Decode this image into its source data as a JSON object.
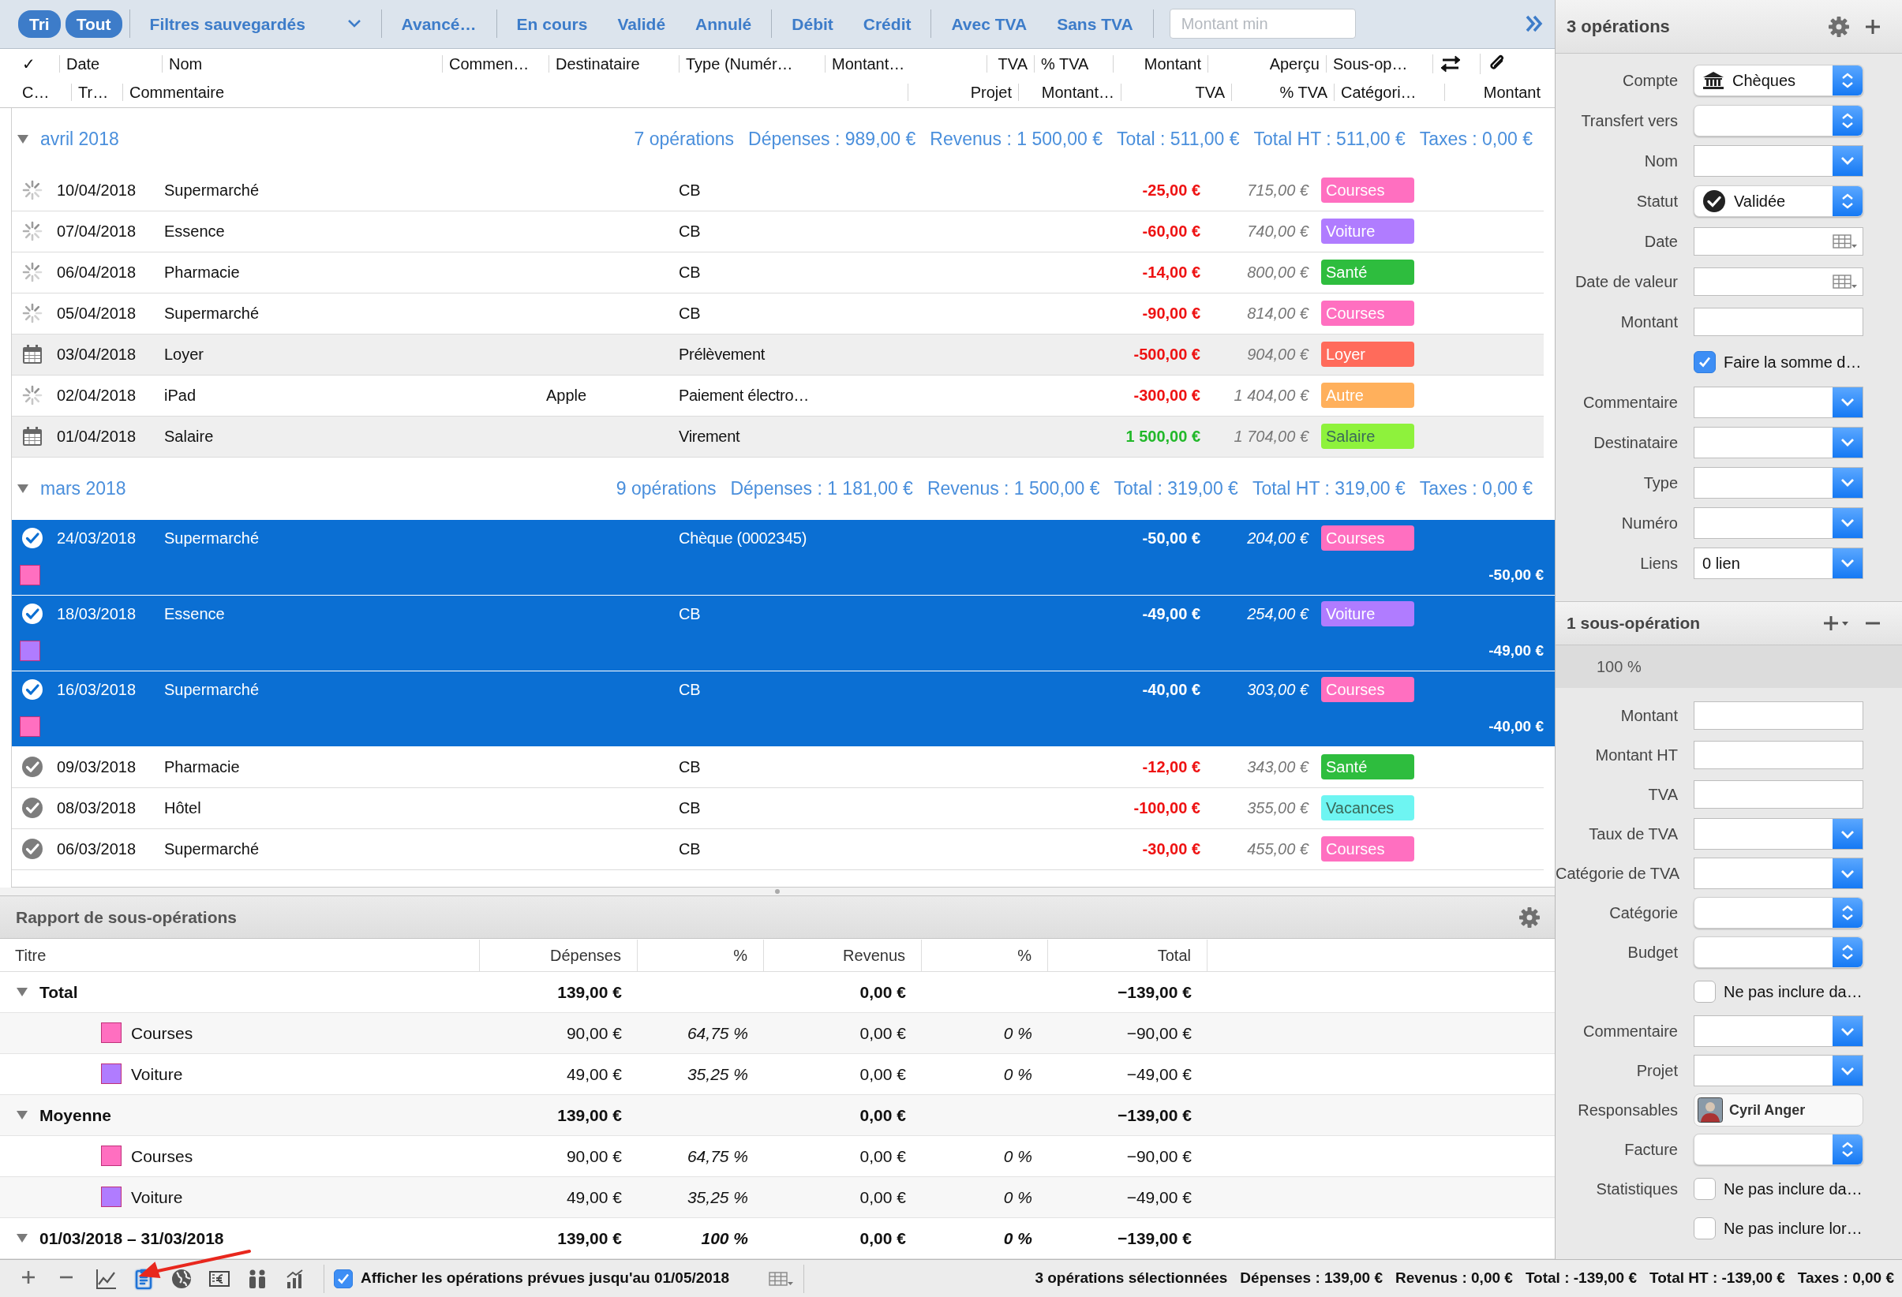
{
  "toolbar": {
    "filter_groups": [
      [
        {
          "label": "Tri",
          "kind": "button",
          "selected": true
        }
      ],
      [
        {
          "label": "Tout",
          "kind": "button",
          "selected": true
        }
      ],
      [
        {
          "label": "Filtres sauvegardés",
          "kind": "menu",
          "selected": false
        }
      ],
      [
        {
          "label": "Avancé…",
          "kind": "button",
          "selected": false
        }
      ],
      [
        {
          "label": "En cours",
          "kind": "button",
          "selected": false
        },
        {
          "label": "Validé",
          "kind": "button",
          "selected": false
        },
        {
          "label": "Annulé",
          "kind": "button",
          "selected": false
        }
      ],
      [
        {
          "label": "Débit",
          "kind": "button",
          "selected": false
        },
        {
          "label": "Crédit",
          "kind": "button",
          "selected": false
        }
      ],
      [
        {
          "label": "Avec TVA",
          "kind": "button",
          "selected": false
        },
        {
          "label": "Sans TVA",
          "kind": "button",
          "selected": false
        }
      ]
    ],
    "search": {
      "placeholder": "Montant min"
    }
  },
  "columns": {
    "row_1": [
      "✓",
      "Date",
      "Nom",
      "Commen…",
      "Destinataire",
      "Type (Numér…",
      "Montant…",
      "TVA",
      "% TVA",
      "Montant",
      "Aperçu",
      "Sous-op…"
    ],
    "row_2": [
      "C…",
      "Tr…",
      "Commentaire",
      "Projet",
      "Montant…",
      "TVA",
      "% TVA",
      "Catégori…",
      "Montant"
    ]
  },
  "groups": [
    {
      "title": "avril 2018",
      "expanded": true,
      "summary": [
        "7 opérations",
        "Dépenses : 989,00 €",
        "Revenus : 1 500,00 €",
        "Total : 511,00 €",
        "Total HT : 511,00 €",
        "Taxes : 0,00 €"
      ],
      "rows": [
        {
          "kind": "pending",
          "selected": false,
          "date": "10/04/2018",
          "name": "Supermarché",
          "type": "CB",
          "amount": "-25,00 €",
          "income": false,
          "balance": "715,00 €",
          "category": {
            "label": "Courses",
            "color": "#ff6fc0"
          }
        },
        {
          "kind": "pending",
          "selected": false,
          "date": "07/04/2018",
          "name": "Essence",
          "type": "CB",
          "amount": "-60,00 €",
          "income": false,
          "balance": "740,00 €",
          "category": {
            "label": "Voiture",
            "color": "#b07cff"
          }
        },
        {
          "kind": "pending",
          "selected": false,
          "date": "06/04/2018",
          "name": "Pharmacie",
          "type": "CB",
          "amount": "-14,00 €",
          "income": false,
          "balance": "800,00 €",
          "category": {
            "label": "Santé",
            "color": "#2ebd3e"
          }
        },
        {
          "kind": "pending",
          "selected": false,
          "date": "05/04/2018",
          "name": "Supermarché",
          "type": "CB",
          "amount": "-90,00 €",
          "income": false,
          "balance": "814,00 €",
          "category": {
            "label": "Courses",
            "color": "#ff6fc0"
          }
        },
        {
          "kind": "planned",
          "selected": false,
          "date": "03/04/2018",
          "name": "Loyer",
          "type": "Prélèvement",
          "amount": "-500,00 €",
          "income": false,
          "balance": "904,00 €",
          "category": {
            "label": "Loyer",
            "color": "#ff6b5b"
          }
        },
        {
          "kind": "pending",
          "selected": false,
          "date": "02/04/2018",
          "name": "iPad",
          "payee": "Apple",
          "type": "Paiement électro…",
          "amount": "-300,00 €",
          "income": false,
          "balance": "1 404,00 €",
          "category": {
            "label": "Autre",
            "color": "#ffb05c"
          }
        },
        {
          "kind": "planned",
          "selected": false,
          "date": "01/04/2018",
          "name": "Salaire",
          "type": "Virement",
          "amount": "1 500,00 €",
          "income": true,
          "balance": "1 704,00 €",
          "category": {
            "label": "Salaire",
            "color": "#8ef23c"
          }
        }
      ]
    },
    {
      "title": "mars 2018",
      "expanded": true,
      "summary": [
        "9 opérations",
        "Dépenses : 1 181,00 €",
        "Revenus : 1 500,00 €",
        "Total : 319,00 €",
        "Total HT : 319,00 €",
        "Taxes : 0,00 €"
      ],
      "rows": [
        {
          "kind": "validated",
          "selected": true,
          "date": "24/03/2018",
          "name": "Supermarché",
          "type": "Chèque (0002345)",
          "amount": "-50,00 €",
          "balance": "204,00 €",
          "category": {
            "label": "Courses",
            "color": "#ff6fc0"
          },
          "split": {
            "color": "#ff6fc0",
            "amount": "-50,00 €"
          }
        },
        {
          "kind": "validated",
          "selected": true,
          "date": "18/03/2018",
          "name": "Essence",
          "type": "CB",
          "amount": "-49,00 €",
          "balance": "254,00 €",
          "category": {
            "label": "Voiture",
            "color": "#b07cff"
          },
          "split": {
            "color": "#b07cff",
            "amount": "-49,00 €"
          }
        },
        {
          "kind": "validated",
          "selected": true,
          "date": "16/03/2018",
          "name": "Supermarché",
          "type": "CB",
          "amount": "-40,00 €",
          "balance": "303,00 €",
          "category": {
            "label": "Courses",
            "color": "#ff6fc0"
          },
          "split": {
            "color": "#ff6fc0",
            "amount": "-40,00 €"
          }
        },
        {
          "kind": "validated",
          "selected": false,
          "date": "09/03/2018",
          "name": "Pharmacie",
          "type": "CB",
          "amount": "-12,00 €",
          "income": false,
          "balance": "343,00 €",
          "category": {
            "label": "Santé",
            "color": "#2ebd3e"
          }
        },
        {
          "kind": "validated",
          "selected": false,
          "date": "08/03/2018",
          "name": "Hôtel",
          "type": "CB",
          "amount": "-100,00 €",
          "income": false,
          "balance": "355,00 €",
          "category": {
            "label": "Vacances",
            "color": "#6ef5f2"
          }
        },
        {
          "kind": "validated",
          "selected": false,
          "date": "06/03/2018",
          "name": "Supermarché",
          "type": "CB",
          "amount": "-30,00 €",
          "income": false,
          "balance": "455,00 €",
          "category": {
            "label": "Courses",
            "color": "#ff6fc0"
          }
        }
      ]
    }
  ],
  "report": {
    "title": "Rapport de sous-opérations",
    "columns": [
      "Titre",
      "Dépenses",
      "%",
      "Revenus",
      "%",
      "Total"
    ],
    "rows": [
      {
        "label": "Total",
        "expanded": true,
        "expenses": "139,00 €",
        "income": "0,00 €",
        "total": "−139,00 €",
        "children": [
          {
            "label": "Courses",
            "color": "#ff6fc0",
            "expenses": "90,00 €",
            "expense_pct": "64,75 %",
            "income": "0,00 €",
            "income_pct": "0 %",
            "total": "−90,00 €"
          },
          {
            "label": "Voiture",
            "color": "#b07cff",
            "expenses": "49,00 €",
            "expense_pct": "35,25 %",
            "income": "0,00 €",
            "income_pct": "0 %",
            "total": "−49,00 €"
          }
        ]
      },
      {
        "label": "Moyenne",
        "expanded": true,
        "expenses": "139,00 €",
        "income": "0,00 €",
        "total": "−139,00 €",
        "children": [
          {
            "label": "Courses",
            "color": "#ff6fc0",
            "expenses": "90,00 €",
            "expense_pct": "64,75 %",
            "income": "0,00 €",
            "income_pct": "0 %",
            "total": "−90,00 €"
          },
          {
            "label": "Voiture",
            "color": "#b07cff",
            "expenses": "49,00 €",
            "expense_pct": "35,25 %",
            "income": "0,00 €",
            "income_pct": "0 %",
            "total": "−49,00 €"
          }
        ]
      },
      {
        "label": "01/03/2018 – 31/03/2018",
        "expanded": true,
        "expenses": "139,00 €",
        "expense_pct": "100 %",
        "income": "0,00 €",
        "income_pct": "0 %",
        "total": "−139,00 €"
      }
    ]
  },
  "inspector": {
    "title": "3 opérations",
    "fields": [
      {
        "label": "Compte",
        "kind": "account",
        "value": "Chèques"
      },
      {
        "label": "Transfert vers",
        "kind": "popup"
      },
      {
        "label": "Nom",
        "kind": "combo"
      },
      {
        "label": "Statut",
        "kind": "status",
        "value": "Validée"
      },
      {
        "label": "Date",
        "kind": "date"
      },
      {
        "label": "Date de valeur",
        "kind": "date"
      },
      {
        "label": "Montant",
        "kind": "text"
      },
      {
        "kind": "checkbox",
        "text": "Faire la somme d…",
        "checked": true
      },
      {
        "label": "Commentaire",
        "kind": "combo"
      },
      {
        "label": "Destinataire",
        "kind": "combo"
      },
      {
        "label": "Type",
        "kind": "combo"
      },
      {
        "label": "Numéro",
        "kind": "combo"
      },
      {
        "label": "Liens",
        "kind": "combo",
        "value": "0 lien"
      }
    ],
    "sub_title": "1 sous-opération",
    "share": "100 %",
    "sub_fields": [
      {
        "label": "Montant",
        "kind": "text"
      },
      {
        "label": "Montant HT",
        "kind": "text"
      },
      {
        "label": "TVA",
        "kind": "text"
      },
      {
        "label": "Taux de TVA",
        "kind": "combo"
      },
      {
        "label": "Catégorie de TVA",
        "kind": "combo"
      },
      {
        "label": "Catégorie",
        "kind": "popup"
      },
      {
        "label": "Budget",
        "kind": "popup"
      },
      {
        "kind": "checkbox",
        "text": "Ne pas inclure da…",
        "checked": false
      },
      {
        "label": "Commentaire",
        "kind": "combo"
      },
      {
        "label": "Projet",
        "kind": "combo"
      },
      {
        "label": "Responsables",
        "kind": "person",
        "value": "Cyril Anger"
      },
      {
        "label": "Facture",
        "kind": "popup"
      },
      {
        "label": "Statistiques",
        "kind": "checkbox",
        "text": "Ne pas inclure da…",
        "checked": false
      },
      {
        "kind": "checkbox",
        "text": "Ne pas inclure lor…",
        "checked": false
      }
    ]
  },
  "bottom_bar": {
    "tools": [
      {
        "kind": "add",
        "selected": false
      },
      {
        "kind": "remove",
        "selected": false
      },
      {
        "kind": "line-chart",
        "selected": false
      },
      {
        "kind": "clipboard",
        "selected": true
      },
      {
        "kind": "globe",
        "selected": false
      },
      {
        "kind": "document",
        "selected": false
      },
      {
        "kind": "people",
        "selected": false
      },
      {
        "kind": "bar-chart",
        "selected": false
      }
    ],
    "show_planned": {
      "checked": true,
      "label": "Afficher les opérations prévues jusqu'au 01/05/2018"
    },
    "status": [
      "3 opérations sélectionnées",
      "Dépenses : 139,00 €",
      "Revenus : 0,00 €",
      "Total : -139,00 €",
      "Total HT : -139,00 €",
      "Taxes : 0,00 €"
    ]
  }
}
